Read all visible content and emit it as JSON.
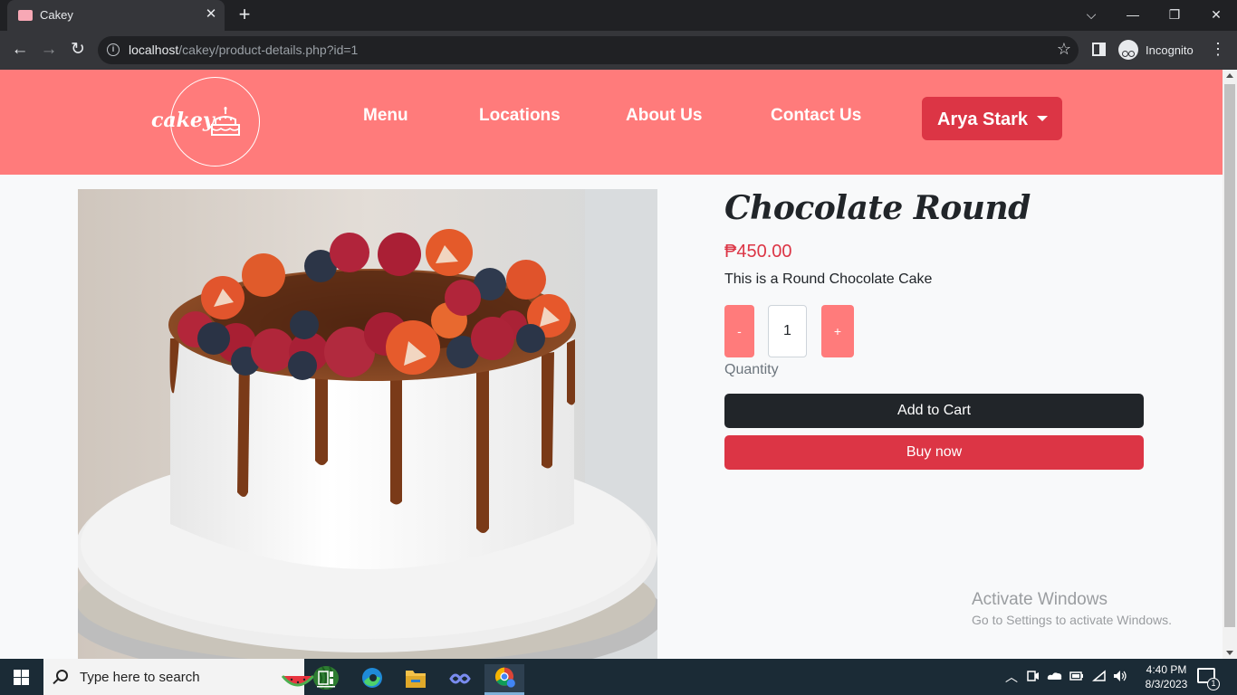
{
  "browser": {
    "tab_title": "Cakey",
    "tab_close": "✕",
    "new_tab": "+",
    "url_host": "localhost",
    "url_path": "/cakey/product-details.php?id=1",
    "profile_label": "Incognito",
    "window_controls": {
      "tab_search": "⌵",
      "minimize": "—",
      "restore": "❐",
      "close": "✕"
    },
    "nav": {
      "back": "←",
      "forward": "→",
      "reload": "↻",
      "bookmark": "☆",
      "menu": "⋮"
    }
  },
  "site": {
    "logo_text": "cakey",
    "nav_links": [
      "Menu",
      "Locations",
      "About Us",
      "Contact Us"
    ],
    "user_name": "Arya Stark"
  },
  "product": {
    "name": "Chocolate Round",
    "price": "₱450.00",
    "description": "This is a Round Chocolate Cake",
    "qty_minus": "-",
    "qty_plus": "+",
    "quantity": "1",
    "quantity_label": "Quantity",
    "add_to_cart": "Add to Cart",
    "buy_now": "Buy now"
  },
  "watermark": {
    "title": "Activate Windows",
    "subtitle": "Go to Settings to activate Windows."
  },
  "taskbar": {
    "search_placeholder": "Type here to search",
    "time": "4:40 PM",
    "date": "8/3/2023",
    "notification_count": "1",
    "tray_chevron": "︿",
    "tray_icons": [
      "meet-now-icon",
      "onedrive-icon",
      "battery-icon",
      "wifi-icon",
      "volume-icon"
    ],
    "pinned_apps": [
      "task-view-icon",
      "edge-icon",
      "file-explorer-icon",
      "app-icon",
      "chrome-icon"
    ]
  },
  "colors": {
    "navbar": "#ff7b7b",
    "danger": "#dc3545",
    "dark": "#212529"
  }
}
